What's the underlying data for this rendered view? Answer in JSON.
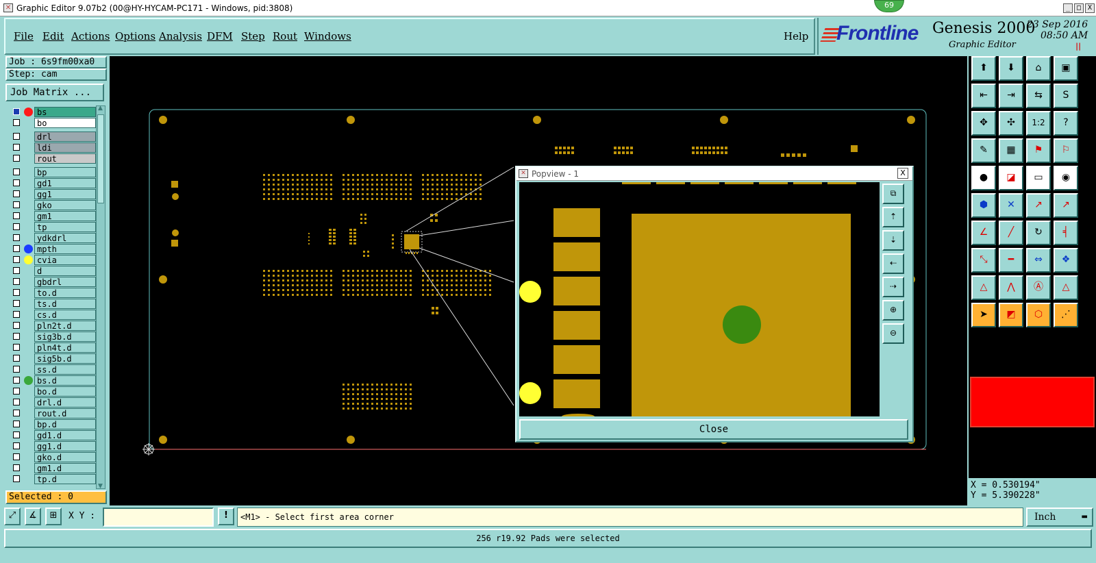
{
  "window": {
    "title": "Graphic Editor 9.07b2 (00@HY-HYCAM-PC171 - Windows, pid:3808)",
    "badge": "69",
    "min_label": "_",
    "max_label": "□",
    "close_label": "X"
  },
  "menu": {
    "items": [
      "File",
      "Edit",
      "Actions",
      "Options",
      "Analysis",
      "DFM",
      "Step",
      "Rout",
      "Windows"
    ],
    "help": "Help"
  },
  "brand": {
    "logo": "Frontline",
    "product": "Genesis 2000",
    "subtitle": "Graphic Editor",
    "date": "23 Sep 2016",
    "time": "08:50 AM",
    "pause": "||"
  },
  "job": {
    "job_label": "Job : 6s9fm00xa0",
    "step_label": "Step: cam",
    "matrix_button": "Job Matrix ..."
  },
  "layers": [
    {
      "name": "bs",
      "dot": "#ff1a1a",
      "active": true
    },
    {
      "name": "bo",
      "dot": "",
      "bg": "#ffffff"
    },
    {
      "name": "drl",
      "dot": "",
      "bg": "#9aa8ae"
    },
    {
      "name": "ldi",
      "dot": "",
      "bg": "#9aa8ae"
    },
    {
      "name": "rout",
      "dot": "",
      "bg": "#c9c9c9"
    },
    {
      "name": "bp",
      "dot": ""
    },
    {
      "name": "gd1",
      "dot": ""
    },
    {
      "name": "gg1",
      "dot": ""
    },
    {
      "name": "gko",
      "dot": ""
    },
    {
      "name": "gm1",
      "dot": ""
    },
    {
      "name": "tp",
      "dot": ""
    },
    {
      "name": "ydkdrl",
      "dot": ""
    },
    {
      "name": "mpth",
      "dot": "#1a3cff"
    },
    {
      "name": "cvia",
      "dot": "#ffff33"
    },
    {
      "name": "d",
      "dot": ""
    },
    {
      "name": "gbdrl",
      "dot": ""
    },
    {
      "name": "to.d",
      "dot": ""
    },
    {
      "name": "ts.d",
      "dot": ""
    },
    {
      "name": "cs.d",
      "dot": ""
    },
    {
      "name": "pln2t.d",
      "dot": ""
    },
    {
      "name": "sig3b.d",
      "dot": ""
    },
    {
      "name": "pln4t.d",
      "dot": ""
    },
    {
      "name": "sig5b.d",
      "dot": ""
    },
    {
      "name": "ss.d",
      "dot": ""
    },
    {
      "name": "bs.d",
      "dot": "#3aa83a"
    },
    {
      "name": "bo.d",
      "dot": ""
    },
    {
      "name": "drl.d",
      "dot": ""
    },
    {
      "name": "rout.d",
      "dot": ""
    },
    {
      "name": "bp.d",
      "dot": ""
    },
    {
      "name": "gd1.d",
      "dot": ""
    },
    {
      "name": "gg1.d",
      "dot": ""
    },
    {
      "name": "gko.d",
      "dot": ""
    },
    {
      "name": "gm1.d",
      "dot": ""
    },
    {
      "name": "tp.d",
      "dot": ""
    }
  ],
  "selected": "Selected : 0",
  "popview": {
    "title": "Popview - 1",
    "close_label": "Close",
    "close_x": "X"
  },
  "coords": {
    "x": "X = 0.530194\"",
    "y": "Y = 5.390228\""
  },
  "statusbar": {
    "xy_label": "X Y :",
    "prompt_icon": "!",
    "prompt": "<M1> - Select first area corner",
    "units": "Inch",
    "message": "256 r19.92 Pads were selected"
  },
  "colors": {
    "pad": "#c0960a",
    "via": "#ffff33",
    "drill": "#3a8a10",
    "panel": "#9ed8d4",
    "highlight": "#ff0000"
  }
}
